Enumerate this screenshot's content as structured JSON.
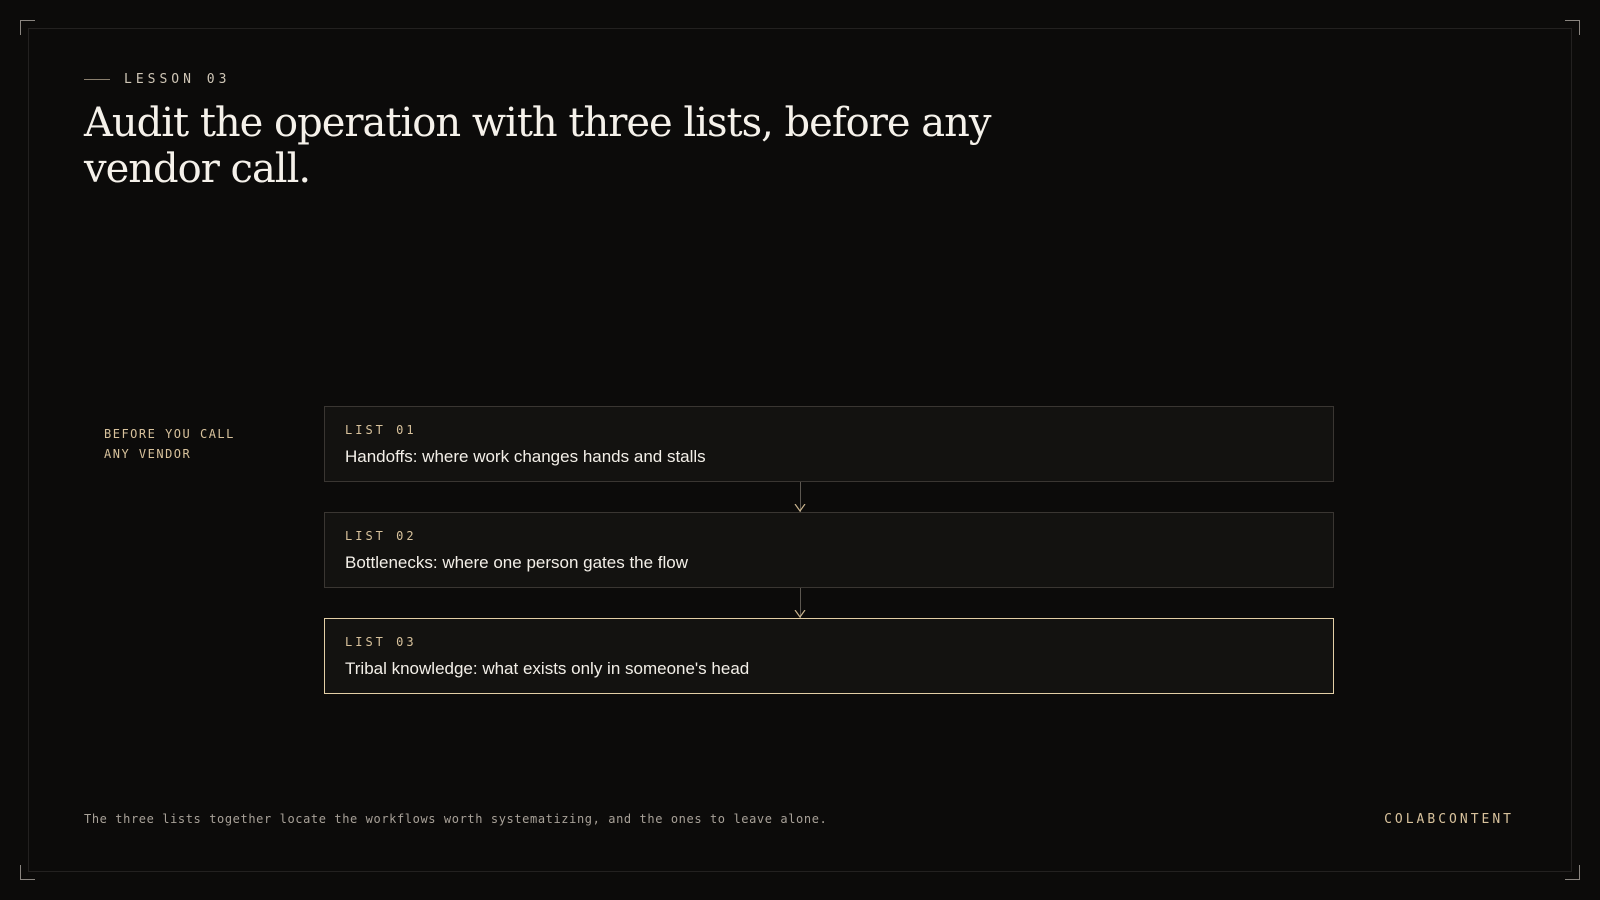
{
  "header": {
    "eyebrow": "LESSON 03",
    "title": "Audit the operation with three lists, before any vendor call."
  },
  "side_label": {
    "line1": "BEFORE YOU CALL",
    "line2": "ANY VENDOR"
  },
  "lists": [
    {
      "tag": "LIST 01",
      "text": "Handoffs: where work changes hands and stalls"
    },
    {
      "tag": "LIST 02",
      "text": "Bottlenecks: where one person gates the flow"
    },
    {
      "tag": "LIST 03",
      "text": "Tribal knowledge: what exists only in someone's head"
    }
  ],
  "footer": {
    "note": "The three lists together locate the workflows worth systematizing, and the ones to leave alone.",
    "brand": "COLABCONTENT"
  },
  "colors": {
    "background": "#0c0b0a",
    "accent": "#d8c29c",
    "highlight_border": "#e3cfa6"
  }
}
